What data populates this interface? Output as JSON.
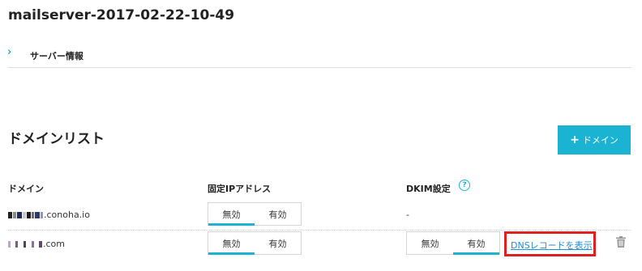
{
  "page": {
    "title": "mailserver-2017-02-22-10-49"
  },
  "subnav": {
    "label": "サーバー情報",
    "icon": "chevron-right-icon"
  },
  "section": {
    "title": "ドメインリスト",
    "add_button_label": "ドメイン",
    "add_icon": "plus-icon"
  },
  "columns": {
    "domain": "ドメイン",
    "fixed_ip": "固定IPアドレス",
    "dkim": "DKIM設定",
    "help_icon": "question-circle-icon",
    "help_glyph": "?"
  },
  "rows": [
    {
      "domain_suffix": ".conoha.io",
      "fixed_ip": {
        "off": "無効",
        "on": "有効",
        "selected": "無効"
      },
      "dkim_text": "-"
    },
    {
      "domain_suffix": ".com",
      "fixed_ip": {
        "off": "無効",
        "on": "有効",
        "selected": "無効"
      },
      "dkim": {
        "off": "無効",
        "on": "有効",
        "selected": "有効"
      },
      "dns_link": "DNSレコードを表示",
      "delete_icon": "trash-icon"
    }
  ],
  "colors": {
    "accent": "#1ab3d1",
    "highlight": "#e02020",
    "link": "#1a8fd8"
  }
}
